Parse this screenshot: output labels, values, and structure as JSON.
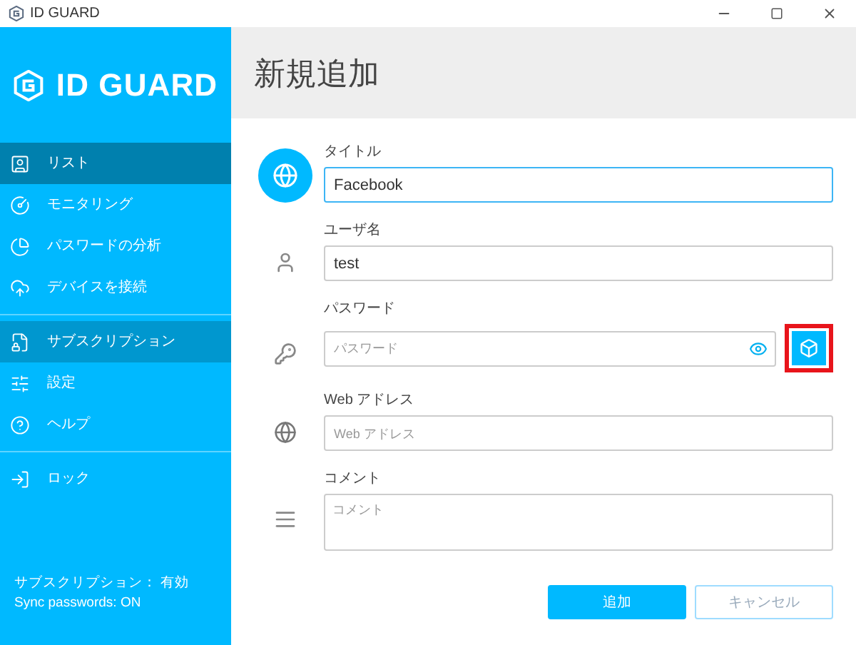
{
  "window": {
    "title": "ID GUARD"
  },
  "sidebar": {
    "logo": "ID GUARD",
    "groups": [
      [
        {
          "label": "リスト",
          "selected": true,
          "hovered": false
        },
        {
          "label": "モニタリング",
          "selected": false,
          "hovered": false
        },
        {
          "label": "パスワードの分析",
          "selected": false,
          "hovered": false
        },
        {
          "label": "デバイスを接続",
          "selected": false,
          "hovered": false
        }
      ],
      [
        {
          "label": "サブスクリプション",
          "selected": false,
          "hovered": true
        },
        {
          "label": "設定",
          "selected": false,
          "hovered": false
        },
        {
          "label": "ヘルプ",
          "selected": false,
          "hovered": false
        }
      ],
      [
        {
          "label": "ロック",
          "selected": false,
          "hovered": false
        }
      ]
    ],
    "status": [
      "サブスクリプション： 有効",
      "Sync passwords: ON"
    ]
  },
  "header": {
    "title": "新規追加"
  },
  "form": {
    "fields": [
      {
        "kind": "title",
        "label": "タイトル",
        "value": "Facebook",
        "focused": true
      },
      {
        "kind": "user",
        "label": "ユーザ名",
        "value": "test",
        "focused": false
      },
      {
        "kind": "password",
        "label": "パスワード",
        "placeholder": "パスワード",
        "focused": false,
        "generate_highlighted": true
      },
      {
        "kind": "web",
        "label": "Web アドレス",
        "placeholder": "Web アドレス",
        "focused": false
      },
      {
        "kind": "comment",
        "label": "コメント",
        "placeholder": "コメント",
        "focused": false
      }
    ],
    "buttons": [
      {
        "label": "追加",
        "kind": "primary"
      },
      {
        "label": "キャンセル",
        "kind": "secondary"
      }
    ]
  }
}
